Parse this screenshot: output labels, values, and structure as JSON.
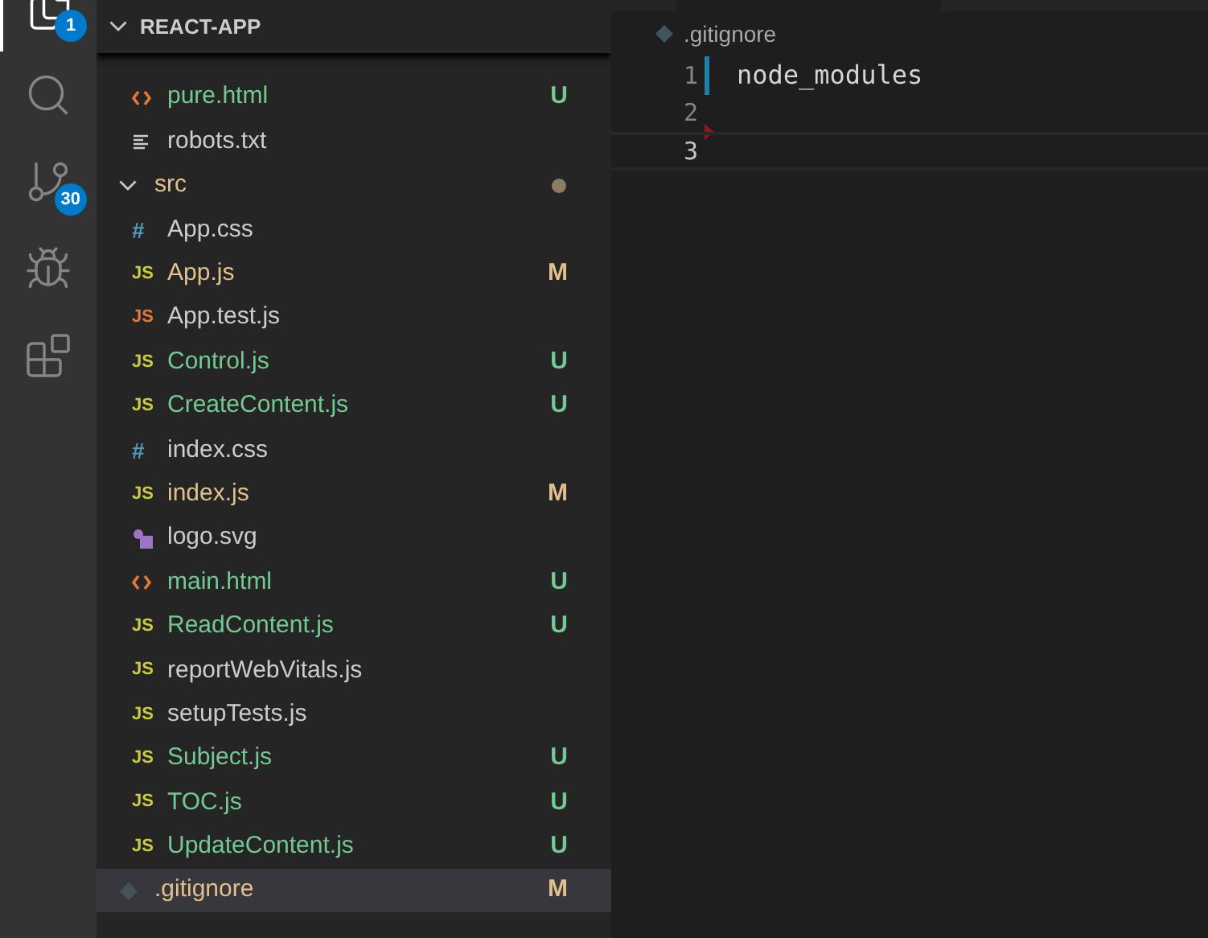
{
  "activity_bar": [
    {
      "kind": "explorer",
      "badge": "1",
      "selected": true
    },
    {
      "kind": "search",
      "selected": false
    },
    {
      "kind": "source-control",
      "badge": "30",
      "selected": false
    },
    {
      "kind": "run-debug",
      "selected": false
    },
    {
      "kind": "extensions",
      "selected": false
    }
  ],
  "explorer": {
    "title": "REACT-APP",
    "expanded": true,
    "items": [
      {
        "kind": "hidden-folder",
        "children": [
          {
            "kind": "html",
            "name": "pure.html",
            "status": "U",
            "selected": false
          },
          {
            "kind": "txt",
            "name": "robots.txt",
            "selected": false
          }
        ]
      },
      {
        "kind": "folder",
        "name": "src",
        "expanded": true,
        "has_changes": true,
        "selected": false,
        "children": [
          {
            "kind": "css",
            "icon": "#",
            "name": "App.css",
            "selected": false
          },
          {
            "kind": "js",
            "icon": "JS",
            "name": "App.js",
            "status": "M",
            "selected": false
          },
          {
            "kind": "js-test",
            "icon": "JS",
            "name": "App.test.js",
            "selected": false
          },
          {
            "kind": "js",
            "icon": "JS",
            "name": "Control.js",
            "status": "U",
            "selected": false
          },
          {
            "kind": "js",
            "icon": "JS",
            "name": "CreateContent.js",
            "status": "U",
            "selected": false
          },
          {
            "kind": "css",
            "icon": "#",
            "name": "index.css",
            "selected": false
          },
          {
            "kind": "js",
            "icon": "JS",
            "name": "index.js",
            "status": "M",
            "selected": false
          },
          {
            "kind": "svg",
            "name": "logo.svg",
            "selected": false
          },
          {
            "kind": "html",
            "name": "main.html",
            "status": "U",
            "selected": false
          },
          {
            "kind": "js",
            "icon": "JS",
            "name": "ReadContent.js",
            "status": "U",
            "selected": false
          },
          {
            "kind": "js",
            "icon": "JS",
            "name": "reportWebVitals.js",
            "selected": false
          },
          {
            "kind": "js",
            "icon": "JS",
            "name": "setupTests.js",
            "selected": false
          },
          {
            "kind": "js",
            "icon": "JS",
            "name": "Subject.js",
            "status": "U",
            "selected": false
          },
          {
            "kind": "js",
            "icon": "JS",
            "name": "TOC.js",
            "status": "U",
            "selected": false
          },
          {
            "kind": "js",
            "icon": "JS",
            "name": "UpdateContent.js",
            "status": "U",
            "selected": false
          }
        ]
      },
      {
        "kind": "git",
        "name": ".gitignore",
        "status": "M",
        "selected": true
      }
    ]
  },
  "editor": {
    "breadcrumb": ".gitignore",
    "lines": [
      {
        "number": "1",
        "text": "node_modules",
        "modified": true,
        "deleted_below": false,
        "current": false
      },
      {
        "number": "2",
        "modified": false,
        "deleted_below": true,
        "current": false
      },
      {
        "number": "3",
        "modified": false,
        "deleted_below": false,
        "current": true
      }
    ]
  }
}
